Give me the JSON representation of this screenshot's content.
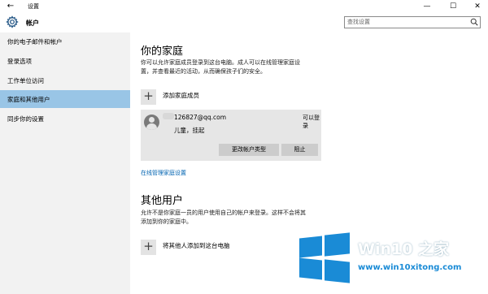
{
  "window": {
    "title": "设置",
    "back": "←",
    "controls": {
      "minimize": "—",
      "maximize": "☐",
      "close": "✕"
    }
  },
  "header": {
    "section": "帐户",
    "search_placeholder": "查找设置"
  },
  "sidebar": {
    "items": [
      {
        "label": "你的电子邮件和帐户"
      },
      {
        "label": "登录选项"
      },
      {
        "label": "工作单位访问"
      },
      {
        "label": "家庭和其他用户"
      },
      {
        "label": "同步你的设置"
      }
    ],
    "selected_index": 3
  },
  "family": {
    "heading": "你的家庭",
    "desc_line1": "你可以允许家庭成员登录到这台电脑。成人可以在线管理家庭设",
    "desc_line2": "置，并查看最近的活动，从而确保孩子们的安全。",
    "add_label": "添加家庭成员",
    "member": {
      "email": "126827@qq.com",
      "can_login": "可以登录",
      "status": "儿童，挂起",
      "change_type_button": "更改帐户类型",
      "block_button": "阻止"
    },
    "manage_link": "在线管理家庭设置"
  },
  "others": {
    "heading": "其他用户",
    "desc_line1": "允许不是你家庭一员的用户使用自己的帐户来登录。这样不会将其",
    "desc_line2": "添加到你的家庭中。",
    "add_label": "将其他人添加到这台电脑"
  },
  "watermark": {
    "name": "Win10 之家",
    "url": "www.win10xitong.com",
    "color": "#1a8bd6"
  },
  "colors": {
    "selected_bg": "#99c5e6",
    "link": "#0063b1",
    "sidebar_bg": "#f2f2f2"
  },
  "icons": {
    "add": "+",
    "gear": "gear-icon",
    "search": "search-icon",
    "avatar": "user-avatar-icon"
  }
}
